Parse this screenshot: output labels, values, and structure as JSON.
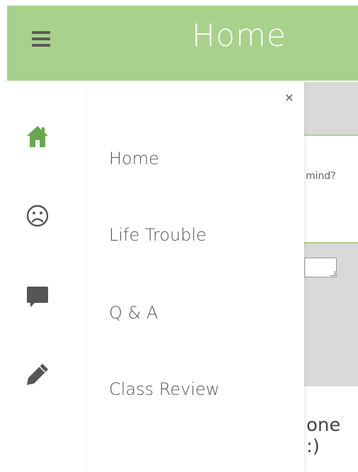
{
  "header": {
    "title": "Home",
    "menu_icon": "hamburger-menu-icon"
  },
  "drawer": {
    "close_label": "×",
    "items": [
      {
        "label": "Home",
        "icon": "home-icon"
      },
      {
        "label": "Life Trouble",
        "icon": "frown-icon"
      },
      {
        "label": "Q & A",
        "icon": "chat-bubble-icon"
      },
      {
        "label": "Class Review",
        "icon": "pencil-icon"
      }
    ]
  },
  "background": {
    "prompt_fragment": "mind?",
    "bottom_fragment": "one :)"
  },
  "colors": {
    "accent": "#a8d18b",
    "home_icon": "#6aa84f",
    "icon_gray": "#555555"
  }
}
